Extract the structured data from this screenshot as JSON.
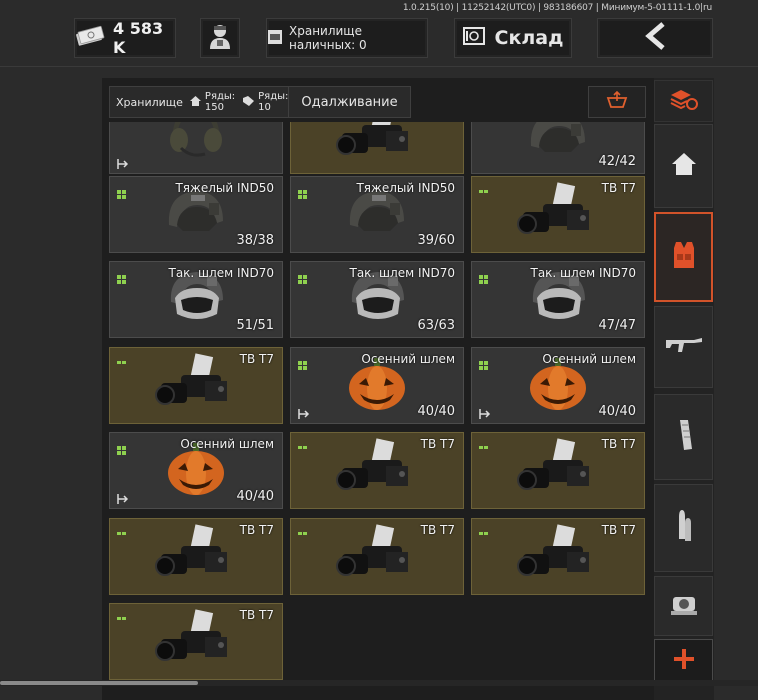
{
  "header": {
    "version": "1.0.215(10) | 11252142(UTC0) | 983186607 | Минимум-5-01111-1.0|ru",
    "money": "4 583 K",
    "cash_storage": "Хранилище наличных: 0",
    "warehouse": "Склад"
  },
  "tabs": {
    "storage_label": "Хранилище",
    "rows_house": "Ряды: 150",
    "rows_tag": "Ряды: 10",
    "lending": "Одалживание"
  },
  "colors": {
    "accent": "#d2532a",
    "gold_card": "#4b4227",
    "grey_card": "#353535",
    "green_marker": "#8fd14f",
    "plus": "#e0512a"
  },
  "items": [
    {
      "name": "",
      "qty": "",
      "type": "headset",
      "gold": false,
      "marker": false,
      "export": true
    },
    {
      "name": "",
      "qty": "",
      "type": "nvg",
      "gold": true,
      "marker": false,
      "export": false
    },
    {
      "name": "",
      "qty": "42/42",
      "type": "helmet",
      "gold": false,
      "marker": false,
      "export": false
    },
    {
      "name": "Тяжелый IND50",
      "qty": "38/38",
      "type": "helmet",
      "gold": false,
      "marker": true,
      "export": false
    },
    {
      "name": "Тяжелый IND50",
      "qty": "39/60",
      "type": "helmet",
      "gold": false,
      "marker": true,
      "export": false
    },
    {
      "name": "ТВ Т7",
      "qty": "",
      "type": "nvg",
      "gold": true,
      "marker": true,
      "export": false
    },
    {
      "name": "Так. шлем IND70",
      "qty": "51/51",
      "type": "visor",
      "gold": false,
      "marker": true,
      "export": false
    },
    {
      "name": "Так. шлем IND70",
      "qty": "63/63",
      "type": "visor",
      "gold": false,
      "marker": true,
      "export": false
    },
    {
      "name": "Так. шлем IND70",
      "qty": "47/47",
      "type": "visor",
      "gold": false,
      "marker": true,
      "export": false
    },
    {
      "name": "ТВ Т7",
      "qty": "",
      "type": "nvg",
      "gold": true,
      "marker": true,
      "export": false
    },
    {
      "name": "Осенний шлем",
      "qty": "40/40",
      "type": "pumpkin",
      "gold": false,
      "marker": true,
      "export": true
    },
    {
      "name": "Осенний шлем",
      "qty": "40/40",
      "type": "pumpkin",
      "gold": false,
      "marker": true,
      "export": true
    },
    {
      "name": "Осенний шлем",
      "qty": "40/40",
      "type": "pumpkin",
      "gold": false,
      "marker": true,
      "export": true
    },
    {
      "name": "ТВ Т7",
      "qty": "",
      "type": "nvg",
      "gold": true,
      "marker": true,
      "export": false
    },
    {
      "name": "ТВ Т7",
      "qty": "",
      "type": "nvg",
      "gold": true,
      "marker": true,
      "export": false
    },
    {
      "name": "ТВ Т7",
      "qty": "",
      "type": "nvg",
      "gold": true,
      "marker": true,
      "export": false
    },
    {
      "name": "ТВ Т7",
      "qty": "",
      "type": "nvg",
      "gold": true,
      "marker": true,
      "export": false
    },
    {
      "name": "ТВ Т7",
      "qty": "",
      "type": "nvg",
      "gold": true,
      "marker": true,
      "export": false
    },
    {
      "name": "ТВ Т7",
      "qty": "",
      "type": "nvg",
      "gold": true,
      "marker": true,
      "export": false
    }
  ],
  "sidebar": [
    {
      "icon": "layers-refresh-icon"
    },
    {
      "icon": "home-icon"
    },
    {
      "icon": "vest-icon",
      "active": true
    },
    {
      "icon": "rifle-icon"
    },
    {
      "icon": "magazine-icon"
    },
    {
      "icon": "ammo-icon"
    },
    {
      "icon": "sight-icon"
    },
    {
      "icon": "plus-icon"
    }
  ]
}
